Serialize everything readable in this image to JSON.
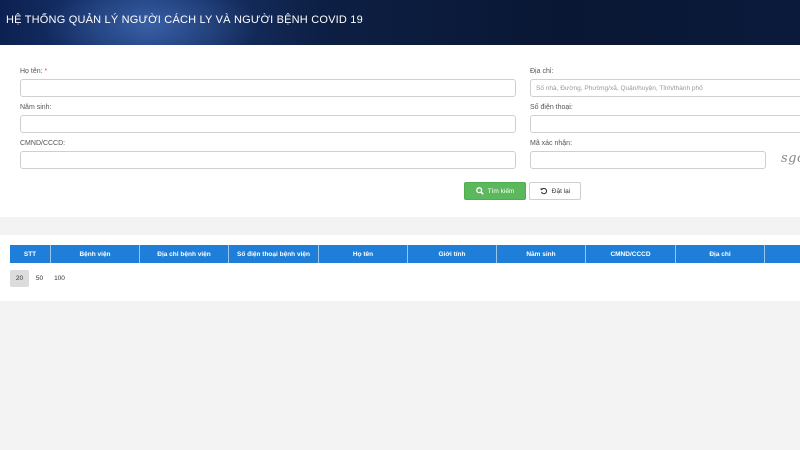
{
  "header": {
    "title": "HỆ THỐNG QUẢN LÝ NGƯỜI CÁCH LY VÀ NGƯỜI BỆNH COVID 19"
  },
  "form": {
    "name_label": "Họ tên:",
    "name_required": "*",
    "name_value": "",
    "birthyear_label": "Năm sinh:",
    "birthyear_value": "",
    "id_label": "CMND/CCCD:",
    "id_value": "",
    "address_label": "Địa chỉ:",
    "address_placeholder": "Số nhà, Đường, Phường/xã, Quận/huyện, Tỉnh/thành phố",
    "phone_label": "Số điện thoại:",
    "phone_value": "",
    "captcha_label": "Mã xác nhận:",
    "captcha_value": "",
    "captcha_text": "sgo",
    "search_button": "Tìm kiếm",
    "reset_button": "Đặt lại",
    "search_icon": "search-icon",
    "reset_icon": "undo-icon"
  },
  "table": {
    "columns": [
      "STT",
      "Bệnh viện",
      "Địa chỉ bệnh viện",
      "Số điện thoại bệnh viện",
      "Họ tên",
      "Giới tính",
      "Năm sinh",
      "CMND/CCCD",
      "Địa chỉ",
      ""
    ],
    "rows": [],
    "page_sizes": [
      "20",
      "50",
      "100"
    ],
    "selected_page_size": "20"
  },
  "colors": {
    "header_bg": "#0d1f44",
    "table_header": "#1f7fd8",
    "search_button": "#5cb85c"
  }
}
